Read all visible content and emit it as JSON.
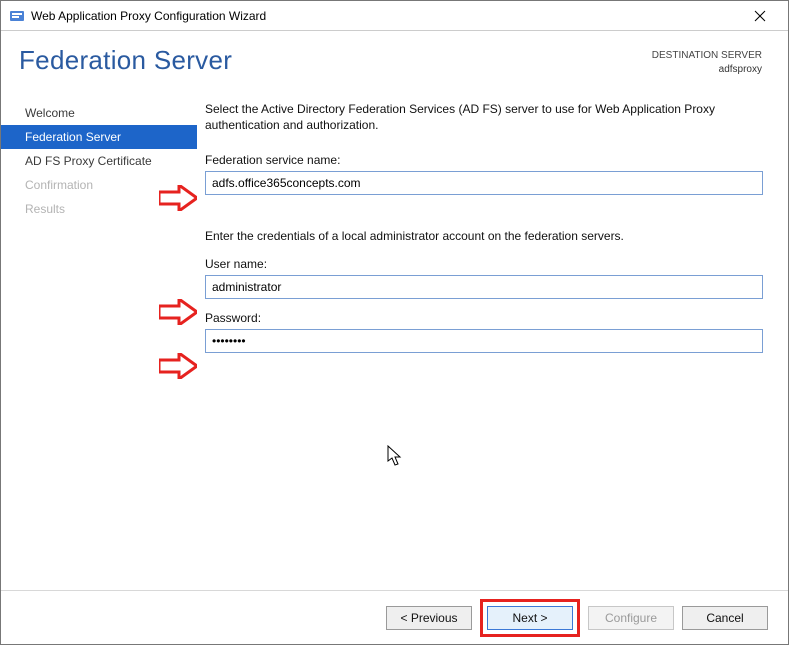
{
  "window": {
    "title": "Web Application Proxy Configuration Wizard"
  },
  "header": {
    "page_title": "Federation Server",
    "destination_label": "DESTINATION SERVER",
    "destination_value": "adfsproxy"
  },
  "sidebar": {
    "items": [
      {
        "label": "Welcome",
        "state": "normal"
      },
      {
        "label": "Federation Server",
        "state": "active"
      },
      {
        "label": "AD FS Proxy Certificate",
        "state": "normal"
      },
      {
        "label": "Confirmation",
        "state": "disabled"
      },
      {
        "label": "Results",
        "state": "disabled"
      }
    ]
  },
  "content": {
    "instruction": "Select the Active Directory Federation Services (AD FS) server to use for Web Application Proxy authentication and authorization.",
    "federation_label": "Federation service name:",
    "federation_value": "adfs.office365concepts.com",
    "credentials_instruction": "Enter the credentials of a local administrator account on the federation servers.",
    "username_label": "User name:",
    "username_value": "administrator",
    "password_label": "Password:",
    "password_value": "••••••••"
  },
  "footer": {
    "previous": "< Previous",
    "next": "Next >",
    "configure": "Configure",
    "cancel": "Cancel"
  }
}
